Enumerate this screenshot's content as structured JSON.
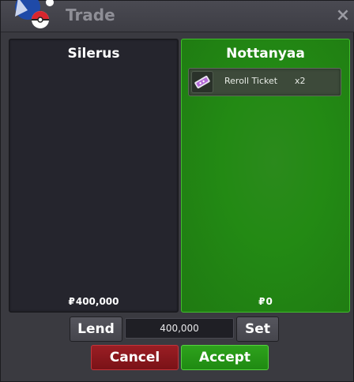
{
  "window": {
    "title": "Trade",
    "close_glyph": "×"
  },
  "left_panel": {
    "name": "Silerus",
    "currency_symbol": "₽",
    "money": "400,000"
  },
  "right_panel": {
    "name": "Nottanyaa",
    "currency_symbol": "₽",
    "money": "0",
    "items": [
      {
        "icon": "ticket-icon",
        "name": "Reroll Ticket",
        "quantity": "x2"
      }
    ]
  },
  "controls": {
    "lend_label": "Lend",
    "amount_value": "400,000",
    "set_label": "Set",
    "cancel_label": "Cancel",
    "accept_label": "Accept"
  },
  "colors": {
    "ready_panel": "#238a14",
    "cancel": "#8a181d",
    "accept": "#28961a"
  }
}
